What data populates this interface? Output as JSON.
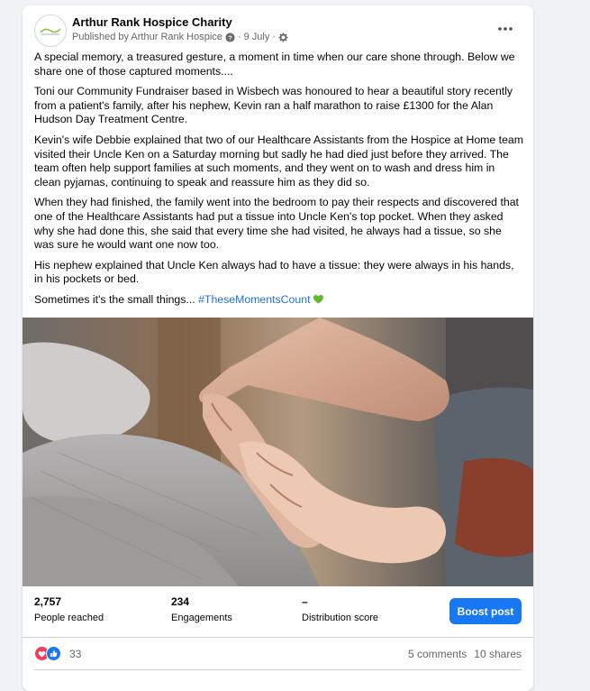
{
  "post": {
    "page_name": "Arthur Rank Hospice Charity",
    "published_by": "Published by Arthur Rank Hospice",
    "date": "9 July",
    "paragraphs": [
      "A special memory, a treasured gesture, a moment in time when our care shone through. Below we share one of those captured moments....",
      "Toni our Community Fundraiser based in Wisbech was honoured to hear a beautiful story recently from a patient's family, after his nephew, Kevin ran a half marathon to raise £1300 for the Alan Hudson Day Treatment Centre.",
      "Kevin's wife Debbie explained that two of our Healthcare Assistants from the Hospice at Home team visited their Uncle Ken on a Saturday morning but sadly he had died just before they arrived. The team often help support families at such moments, and they went on to wash and dress him in clean pyjamas, continuing to speak and reassure him as they did so.",
      "When they had finished, the family went into the bedroom to pay their respects and discovered that one of the Healthcare Assistants had put a tissue into Uncle Ken's top pocket. When they asked why she had done this, she said that every time she had visited, he always had a tissue, so she was sure he would want one now too.",
      "His nephew explained that Uncle Ken always had to have a tissue: they were always in his hands, in his pockets or bed."
    ],
    "closing_text": "Sometimes it's the small things... ",
    "hashtag": "#TheseMomentsCount",
    "icons": {
      "avatar": "hospice-logo",
      "publisher_badge": "question-circle-icon",
      "audience": "gear-icon",
      "more": "more-options-icon",
      "emoji": "green-heart-icon"
    }
  },
  "insights": {
    "reached_value": "2,757",
    "reached_label": "People reached",
    "engagements_value": "234",
    "engagements_label": "Engagements",
    "distribution_value": "–",
    "distribution_label": "Distribution score",
    "boost_label": "Boost post"
  },
  "reactions": {
    "count": "33",
    "comments": "5 comments",
    "shares": "10 shares",
    "colors": {
      "love": "#f33e58",
      "like": "#1877f2"
    }
  },
  "separators": {
    "dot": "·"
  }
}
